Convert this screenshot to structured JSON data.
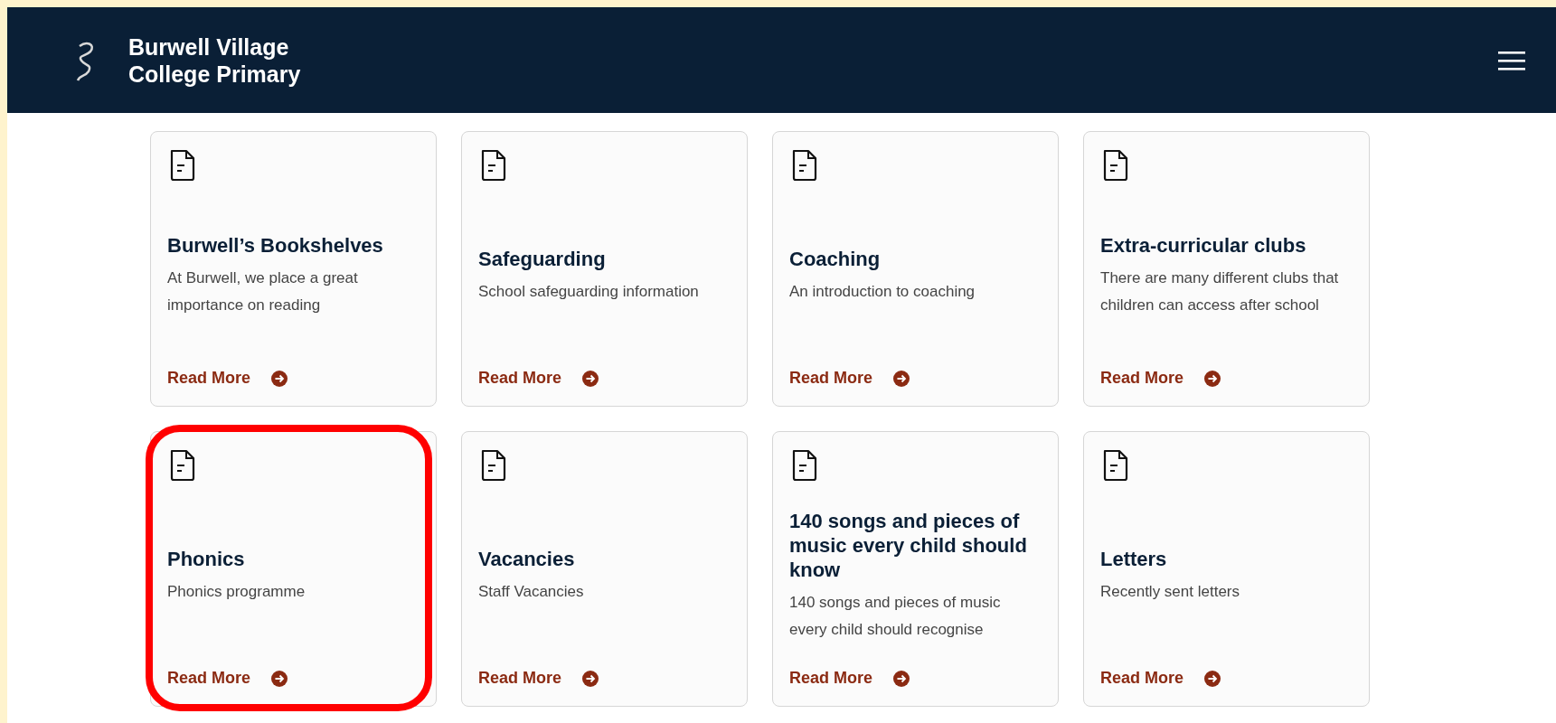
{
  "header": {
    "title_line1": "Burwell Village",
    "title_line2": "College Primary"
  },
  "cards": [
    {
      "title": "Burwell’s Bookshelves",
      "description": "At Burwell, we place a great importance on reading",
      "link": "Read More",
      "highlighted": false
    },
    {
      "title": "Safeguarding",
      "description": "School safeguarding information",
      "link": "Read More",
      "highlighted": false
    },
    {
      "title": "Coaching",
      "description": "An introduction to coaching",
      "link": "Read More",
      "highlighted": false
    },
    {
      "title": "Extra-curricular clubs",
      "description": "There are many different clubs that children can access after school",
      "link": "Read More",
      "highlighted": false
    },
    {
      "title": "Phonics",
      "description": "Phonics programme",
      "link": "Read More",
      "highlighted": true
    },
    {
      "title": "Vacancies",
      "description": "Staff Vacancies",
      "link": "Read More",
      "highlighted": false
    },
    {
      "title": "140 songs and pieces of music every child should know",
      "description": "140 songs and pieces of music every child should recognise",
      "link": "Read More",
      "highlighted": false
    },
    {
      "title": "Letters",
      "description": "Recently sent letters",
      "link": "Read More",
      "highlighted": false
    }
  ]
}
